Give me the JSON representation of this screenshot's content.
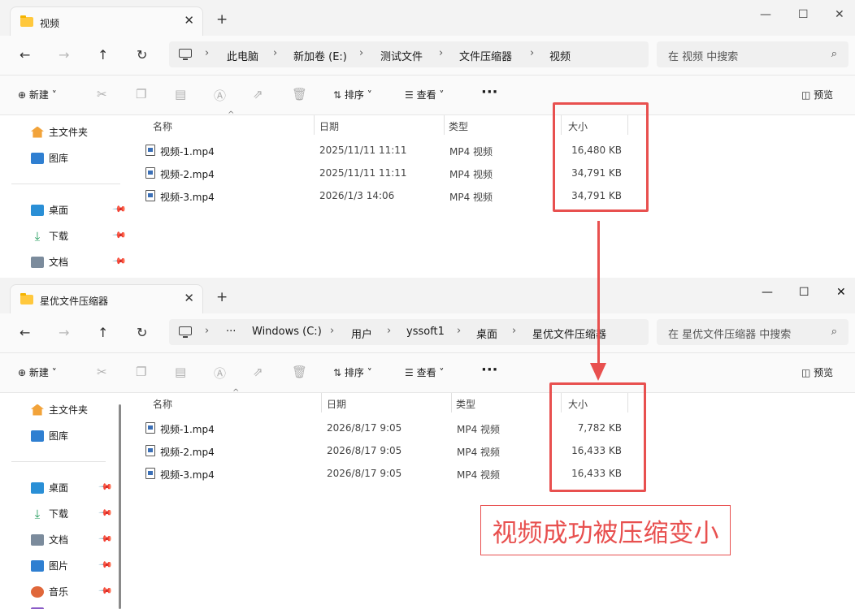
{
  "colors": {
    "accent_red": "#e8504f",
    "folder_yellow": "#ffc83d"
  },
  "windows": [
    {
      "tab_title": "视频",
      "breadcrumbs": [
        "此电脑",
        "新加卷 (E:)",
        "测试文件",
        "文件压缩器",
        "视频"
      ],
      "search_placeholder": "在 视频 中搜索",
      "toolbar": {
        "new_label": "新建",
        "sort_label": "排序",
        "view_label": "查看",
        "more_label": "···",
        "preview_label": "预览"
      },
      "sidebar": {
        "top": [
          {
            "label": "主文件夹",
            "icon": "home-icon"
          },
          {
            "label": "图库",
            "icon": "gallery-icon"
          }
        ],
        "pinned": [
          {
            "label": "桌面",
            "icon": "desktop-icon"
          },
          {
            "label": "下载",
            "icon": "download-icon"
          },
          {
            "label": "文档",
            "icon": "document-icon"
          }
        ]
      },
      "columns": {
        "name": "名称",
        "date": "日期",
        "type": "类型",
        "size": "大小"
      },
      "files": [
        {
          "name": "视频-1.mp4",
          "date": "2025/11/11 11:11",
          "type": "MP4 视频",
          "size": "16,480 KB"
        },
        {
          "name": "视频-2.mp4",
          "date": "2025/11/11 11:11",
          "type": "MP4 视频",
          "size": "34,791 KB"
        },
        {
          "name": "视频-3.mp4",
          "date": "2026/1/3 14:06",
          "type": "MP4 视频",
          "size": "34,791 KB"
        }
      ]
    },
    {
      "tab_title": "星优文件压缩器",
      "breadcrumbs": [
        "···",
        "Windows (C:)",
        "用户",
        "yssoft1",
        "桌面",
        "星优文件压缩器"
      ],
      "search_placeholder": "在 星优文件压缩器 中搜索",
      "toolbar": {
        "new_label": "新建",
        "sort_label": "排序",
        "view_label": "查看",
        "more_label": "···",
        "preview_label": "预览"
      },
      "sidebar": {
        "top": [
          {
            "label": "主文件夹",
            "icon": "home-icon"
          },
          {
            "label": "图库",
            "icon": "gallery-icon"
          }
        ],
        "pinned": [
          {
            "label": "桌面",
            "icon": "desktop-icon"
          },
          {
            "label": "下载",
            "icon": "download-icon"
          },
          {
            "label": "文档",
            "icon": "document-icon"
          },
          {
            "label": "图片",
            "icon": "pictures-icon"
          },
          {
            "label": "音乐",
            "icon": "music-icon"
          }
        ]
      },
      "columns": {
        "name": "名称",
        "date": "日期",
        "type": "类型",
        "size": "大小"
      },
      "files": [
        {
          "name": "视频-1.mp4",
          "date": "2026/8/17 9:05",
          "type": "MP4 视频",
          "size": "7,782 KB"
        },
        {
          "name": "视频-2.mp4",
          "date": "2026/8/17 9:05",
          "type": "MP4 视频",
          "size": "16,433 KB"
        },
        {
          "name": "视频-3.mp4",
          "date": "2026/8/17 9:05",
          "type": "MP4 视频",
          "size": "16,433 KB"
        }
      ]
    }
  ],
  "annotation": {
    "callout_text": "视频成功被压缩变小"
  }
}
